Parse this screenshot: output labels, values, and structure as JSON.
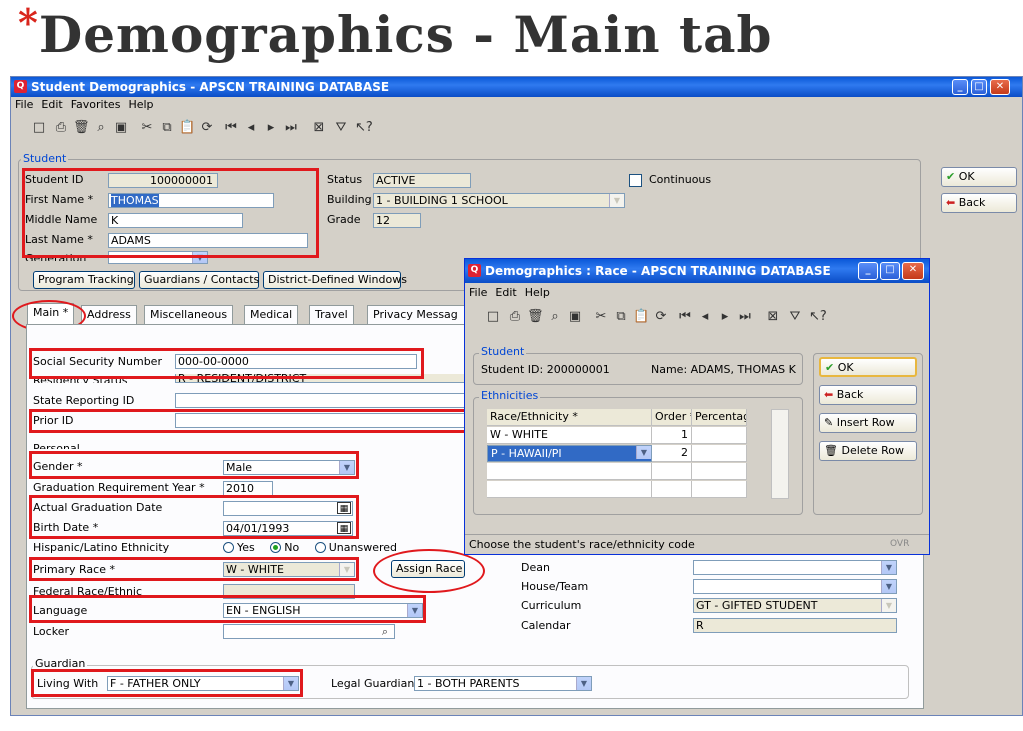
{
  "slide": {
    "star": "*",
    "title": "Demographics - Main tab"
  },
  "main_window": {
    "title": "Student Demographics - APSCN TRAINING DATABASE",
    "menu": [
      "File",
      "Edit",
      "Favorites",
      "Help"
    ],
    "student_group": "Student",
    "student_id_label": "Student ID",
    "student_id": "100000001",
    "first_name_label": "First Name *",
    "first_name": "THOMAS",
    "middle_name_label": "Middle Name",
    "middle_name": "K",
    "last_name_label": "Last Name *",
    "last_name": "ADAMS",
    "generation_label": "Generation",
    "status_label": "Status",
    "status": "ACTIVE",
    "building_label": "Building",
    "building": "1 - BUILDING 1 SCHOOL",
    "grade_label": "Grade",
    "grade": "12",
    "continuous_label": "Continuous",
    "program_tracking": "Program Tracking",
    "guardians_contacts": "Guardians / Contacts",
    "district_windows": "District-Defined Windows",
    "tabs": [
      "Main *",
      "Address",
      "Miscellaneous",
      "Medical",
      "Travel",
      "Privacy Messag"
    ],
    "ssn_label": "Social Security Number",
    "ssn": "000-00-0000",
    "residency_label": "Residency Status",
    "residency": "R - RESIDENT/DISTRICT",
    "state_rep_label": "State Reporting ID",
    "prior_id_label": "Prior ID",
    "personal_group": "Personal",
    "gender_label": "Gender *",
    "gender": "Male",
    "grad_year_label": "Graduation Requirement Year *",
    "grad_year": "2010",
    "actual_grad_label": "Actual Graduation Date",
    "birth_label": "Birth Date *",
    "birth": "04/01/1993",
    "hispanic_label": "Hispanic/Latino Ethnicity",
    "yes": "Yes",
    "no": "No",
    "unanswered": "Unanswered",
    "primary_race_label": "Primary Race *",
    "primary_race": "W - WHITE",
    "assign_race": "Assign Race",
    "federal_race_label": "Federal Race/Ethnic",
    "language_label": "Language",
    "language": "EN - ENGLISH",
    "locker_label": "Locker",
    "dean_label": "Dean",
    "house_label": "House/Team",
    "curriculum_label": "Curriculum",
    "curriculum": "GT - GIFTED STUDENT",
    "calendar_label": "Calendar",
    "calendar": "R",
    "guardian_group": "Guardian",
    "living_with_label": "Living With",
    "living_with": "F - FATHER ONLY",
    "legal_guardian_label": "Legal Guardian",
    "legal_guardian": "1 - BOTH PARENTS",
    "ok": "OK",
    "back": "Back"
  },
  "race_window": {
    "title": "Demographics : Race - APSCN TRAINING DATABASE",
    "menu": [
      "File",
      "Edit",
      "Help"
    ],
    "student_group": "Student",
    "student_id": "Student ID: 200000001",
    "name": "Name: ADAMS, THOMAS K",
    "ethnicities_group": "Ethnicities",
    "col_race": "Race/Ethnicity *",
    "col_order": "Order *",
    "col_pct": "Percentag",
    "rows": [
      {
        "race": "W - WHITE",
        "order": "1"
      },
      {
        "race": "P - HAWAII/PI",
        "order": "2"
      }
    ],
    "ok": "OK",
    "back": "Back",
    "insert_row": "Insert Row",
    "delete_row": "Delete Row",
    "status": "Choose the student's race/ethnicity code",
    "ovr": "OVR"
  }
}
